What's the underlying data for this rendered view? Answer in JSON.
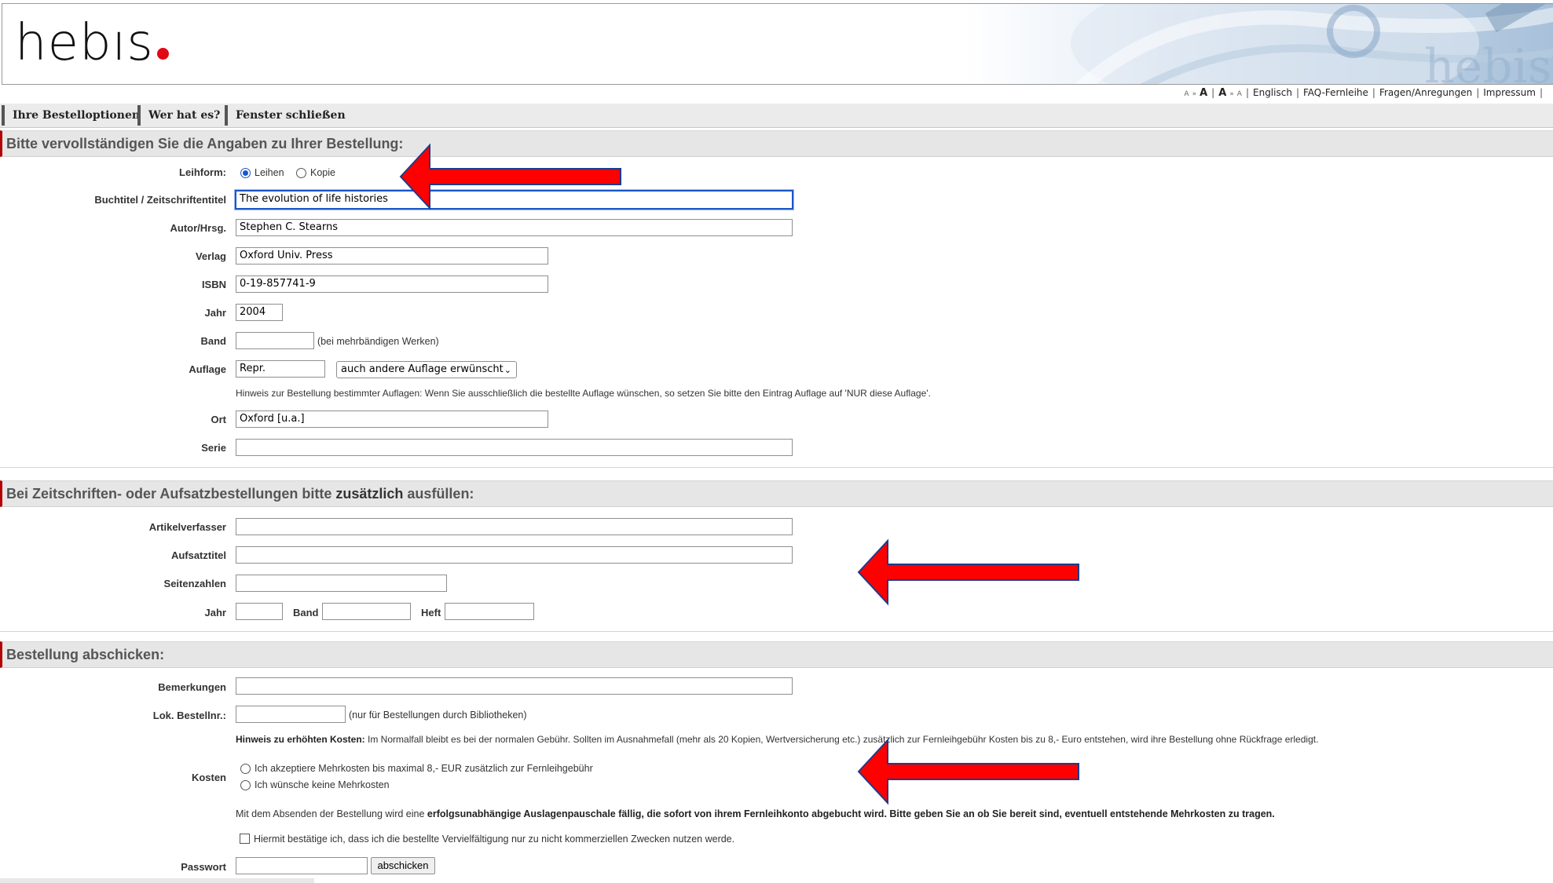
{
  "header": {
    "logo_text": "hebıs",
    "logo_dot_color": "#e30613",
    "toplinks": {
      "font_small_1": "A",
      "font_medium": "A",
      "font_large": "A",
      "font_small_2": "A",
      "raquo1": "»",
      "raquo2": "»",
      "english": "Englisch",
      "faq": "FAQ-Fernleihe",
      "questions": "Fragen/Anregungen",
      "imprint": "Impressum"
    }
  },
  "tabs": [
    "Ihre Bestelloptionen",
    "Wer hat es?",
    "Fenster schließen"
  ],
  "sections": {
    "order": "Bitte vervollständigen Sie die Angaben zu Ihrer Bestellung:",
    "journal_prefix": "Bei Zeitschriften- oder Aufsatzbestellungen bitte ",
    "journal_bold": "zusätzlich",
    "journal_suffix": " ausfüllen:",
    "submit": "Bestellung abschicken:"
  },
  "form": {
    "leihform_label": "Leihform:",
    "leihform_options": [
      "Leihen",
      "Kopie"
    ],
    "leihform_selected": "Leihen",
    "title_label": "Buchtitel / Zeitschriftentitel",
    "title_value": "The evolution of life histories",
    "author_label": "Autor/Hrsg.",
    "author_value": "Stephen C. Stearns",
    "publisher_label": "Verlag",
    "publisher_value": "Oxford Univ. Press",
    "isbn_label": "ISBN",
    "isbn_value": "0-19-857741-9",
    "year_label": "Jahr",
    "year_value": "2004",
    "volume_label": "Band",
    "volume_value": "",
    "volume_note": "(bei mehrbändigen Werken)",
    "edition_label": "Auflage",
    "edition_value": "Repr.",
    "edition_select": "auch andere Auflage erwünscht",
    "edition_hint": "Hinweis zur Bestellung bestimmter Auflagen: Wenn Sie ausschließlich die bestellte Auflage wünschen, so setzen Sie bitte den Eintrag Auflage auf 'NUR diese Auflage'.",
    "place_label": "Ort",
    "place_value": "Oxford [u.a.]",
    "series_label": "Serie",
    "series_value": ""
  },
  "journal": {
    "article_author_label": "Artikelverfasser",
    "article_title_label": "Aufsatztitel",
    "pages_label": "Seitenzahlen",
    "year_label": "Jahr",
    "volume_label": "Band",
    "issue_label": "Heft"
  },
  "submit": {
    "remarks_label": "Bemerkungen",
    "local_order_label": "Lok. Bestellnr.:",
    "local_order_note": "(nur für Bestellungen durch Bibliotheken)",
    "cost_hint_bold": "Hinweis zu erhöhten Kosten:",
    "cost_hint_text": " Im Normalfall bleibt es bei der normalen Gebühr. Sollten im Ausnahmefall (mehr als 20 Kopien, Wertversicherung etc.) zusätzlich zur Fernleihgebühr Kosten bis zu 8,- Euro entstehen, wird ihre Bestellung ohne Rückfrage erledigt.",
    "cost_label": "Kosten",
    "cost_options": [
      "Ich akzeptiere Mehrkosten bis maximal 8,- EUR zusätzlich zur Fernleihgebühr",
      "Ich wünsche keine Mehrkosten"
    ],
    "fee_text_normal": "Mit dem Absenden der Bestellung wird eine ",
    "fee_text_bold1": "erfolgsunabhängige",
    "fee_text_bold2": " Auslagenpauschale fällig, die sofort von ihrem Fernleihkonto abgebucht wird. Bitte geben Sie an ob Sie bereit sind, eventuell entstehende Mehrkosten zu tragen.",
    "confirm_text": "Hiermit bestätige ich, dass ich die bestellte Vervielfältigung nur zu nicht kommerziellen Zwecken nutzen werde.",
    "password_label": "Passwort",
    "submit_button": "abschicken"
  },
  "colors": {
    "accent_red": "#e30613",
    "arrow_red": "#ff0000",
    "arrow_outline": "#1f3a8a",
    "focus_blue": "#1a56c8"
  }
}
